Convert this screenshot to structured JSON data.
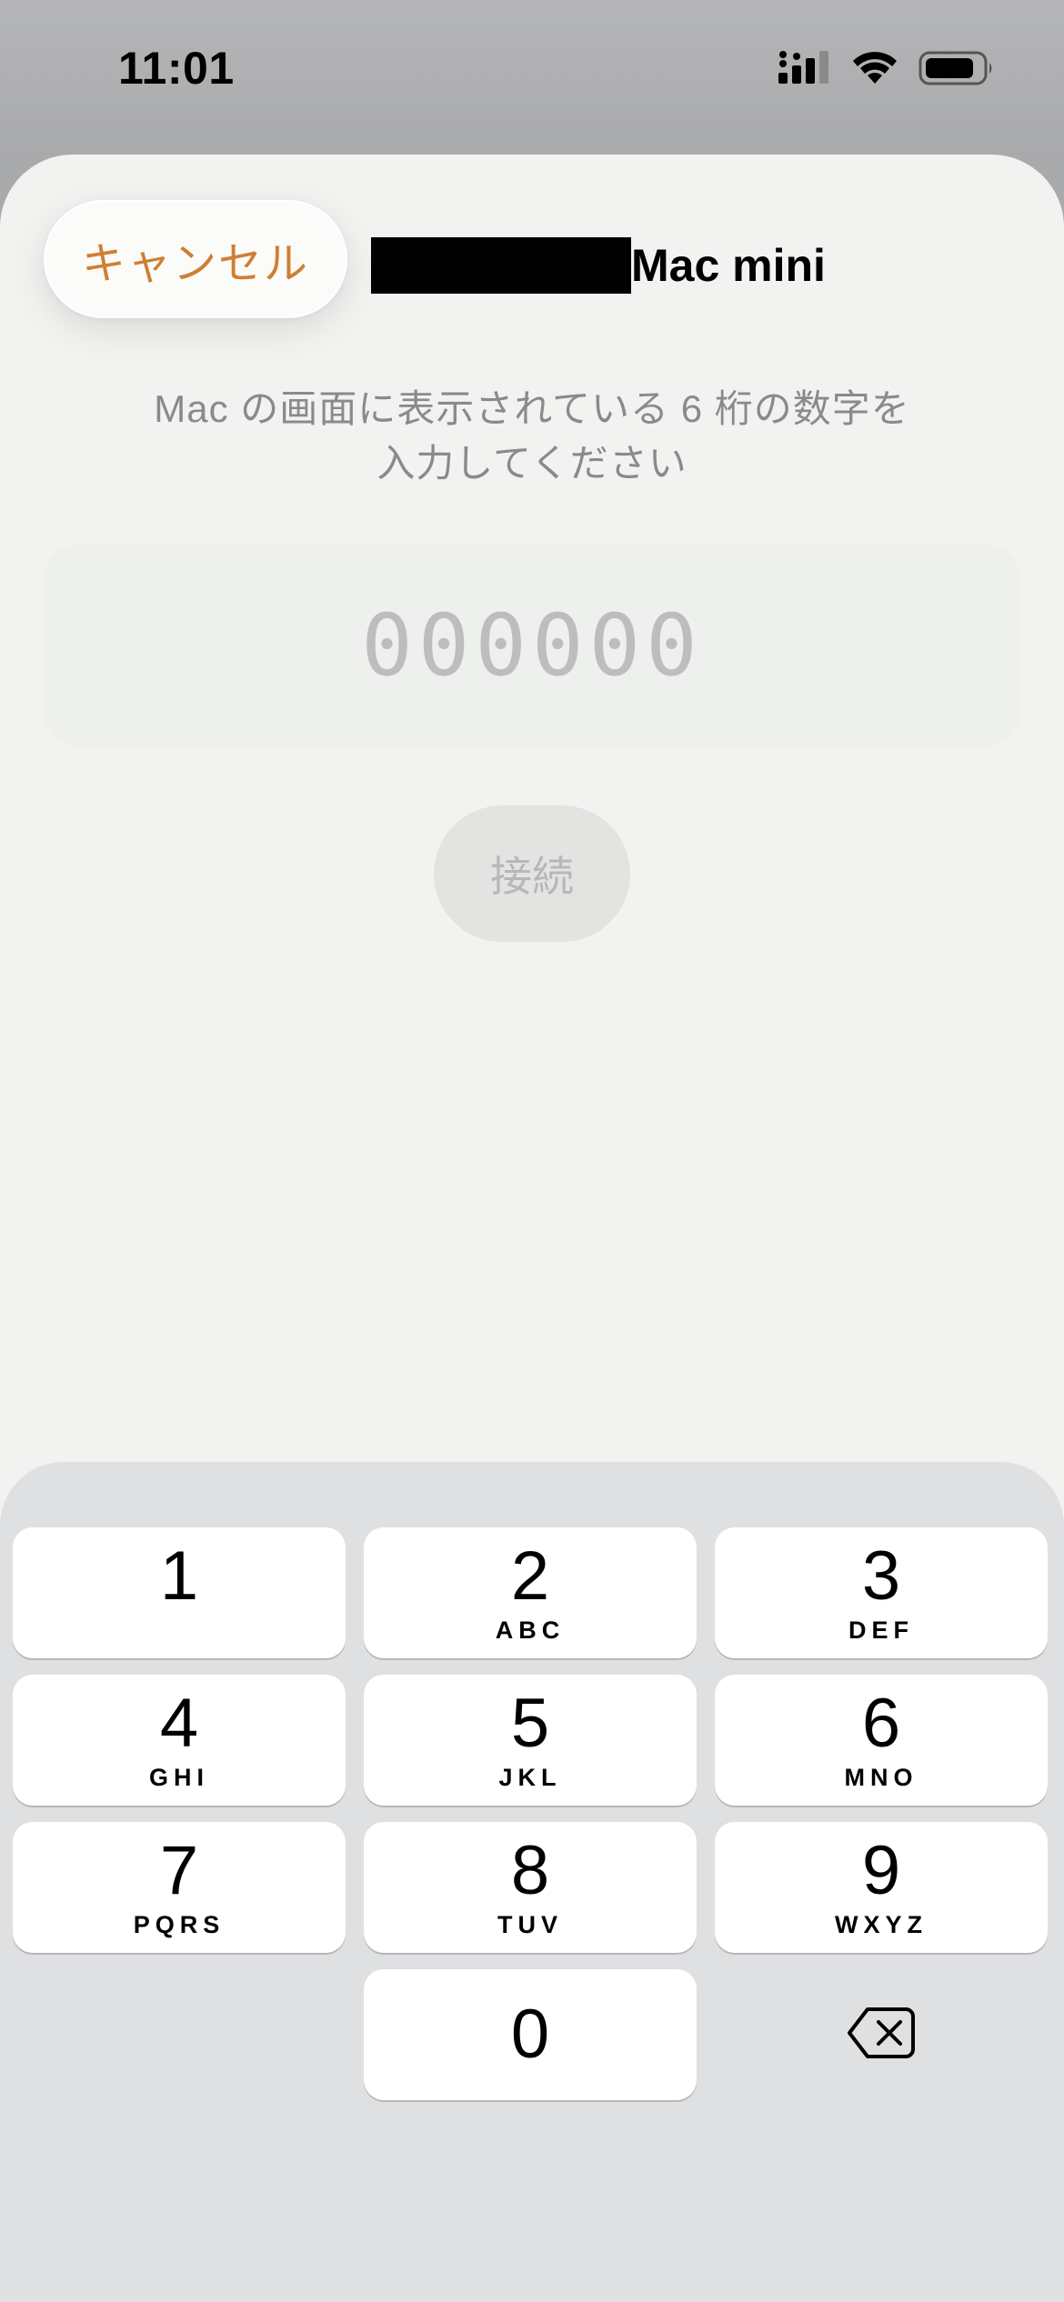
{
  "status_bar": {
    "time": "11:01",
    "icons": [
      "cellular-signal-icon",
      "wifi-icon",
      "battery-icon"
    ]
  },
  "sheet": {
    "cancel_label": "キャンセル",
    "title": "Mac mini",
    "instruction_line1": "Mac の画面に表示されている 6 桁の数字を",
    "instruction_line2": "入力してください",
    "code_placeholder": "000000",
    "code_value": "",
    "connect_label": "接続"
  },
  "keypad": {
    "keys": [
      {
        "digit": "1",
        "letters": ""
      },
      {
        "digit": "2",
        "letters": "ABC"
      },
      {
        "digit": "3",
        "letters": "DEF"
      },
      {
        "digit": "4",
        "letters": "GHI"
      },
      {
        "digit": "5",
        "letters": "JKL"
      },
      {
        "digit": "6",
        "letters": "MNO"
      },
      {
        "digit": "7",
        "letters": "PQRS"
      },
      {
        "digit": "8",
        "letters": "TUV"
      },
      {
        "digit": "9",
        "letters": "WXYZ"
      },
      {
        "digit": "0",
        "letters": ""
      }
    ],
    "delete_icon": "delete-backspace-icon"
  },
  "colors": {
    "accent": "#cf7f33",
    "sheet_background": "#f2f3f1",
    "keypad_background": "#dfe0e2",
    "placeholder_text": "#bdbdbd"
  }
}
